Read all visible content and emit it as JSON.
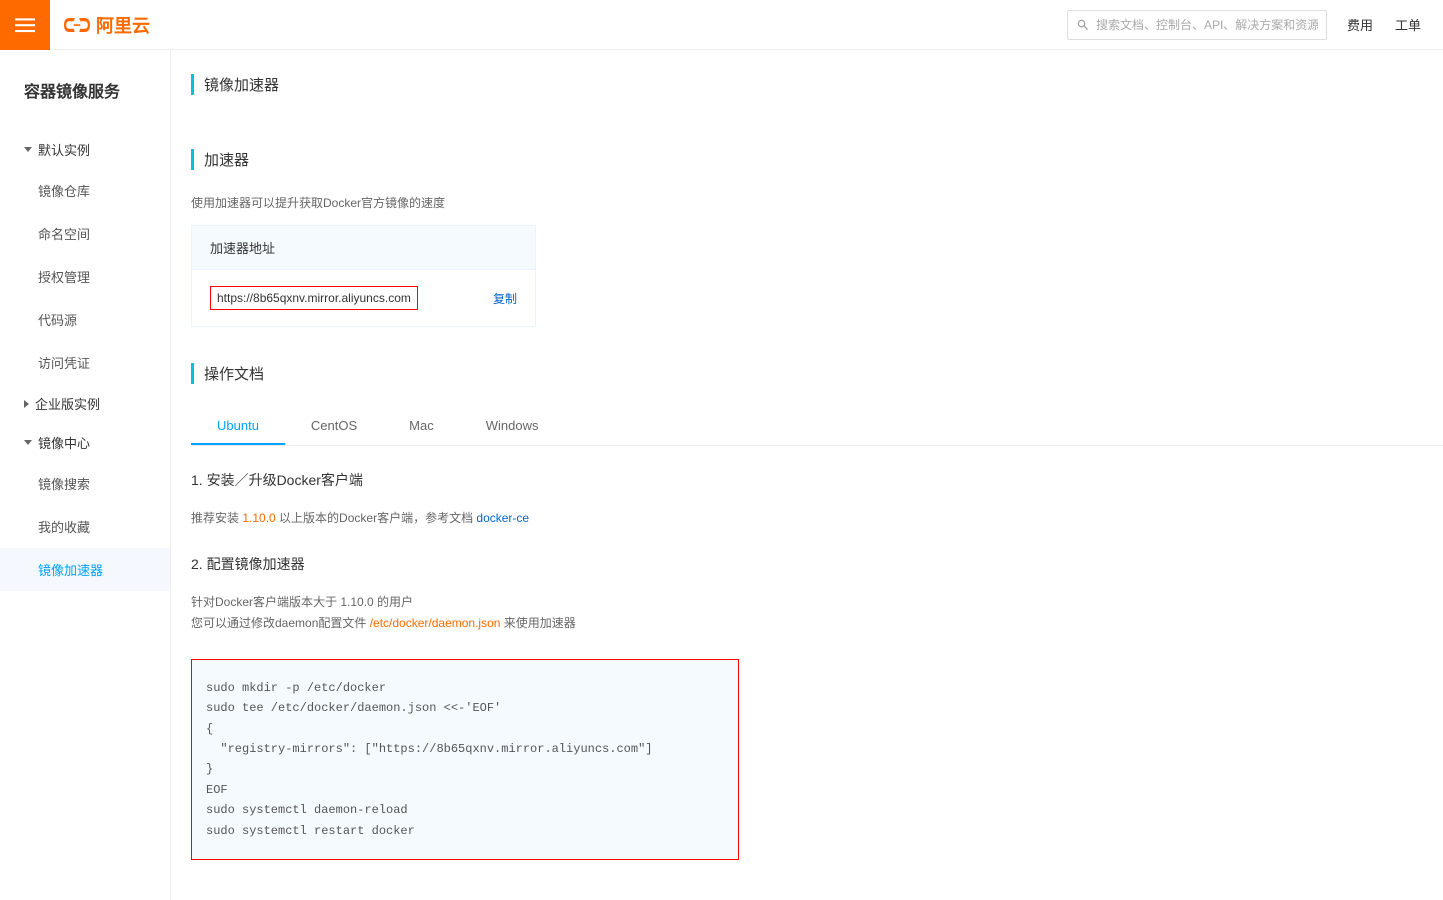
{
  "header": {
    "logo_text": "阿里云",
    "search_placeholder": "搜索文档、控制台、API、解决方案和资源",
    "links": [
      "费用",
      "工单"
    ]
  },
  "sidebar": {
    "service_title": "容器镜像服务",
    "groups": [
      {
        "label": "默认实例",
        "expanded": true,
        "items": [
          "镜像仓库",
          "命名空间",
          "授权管理",
          "代码源",
          "访问凭证"
        ]
      },
      {
        "label": "企业版实例",
        "expanded": false,
        "items": []
      },
      {
        "label": "镜像中心",
        "expanded": true,
        "items": [
          "镜像搜索",
          "我的收藏",
          "镜像加速器"
        ],
        "active_item": "镜像加速器"
      }
    ]
  },
  "main": {
    "page_title": "镜像加速器",
    "accelerator": {
      "section_label": "加速器",
      "desc": "使用加速器可以提升获取Docker官方镜像的速度",
      "addr_label": "加速器地址",
      "url": "https://8b65qxnv.mirror.aliyuncs.com",
      "copy_label": "复制"
    },
    "docs": {
      "section_label": "操作文档",
      "tabs": [
        "Ubuntu",
        "CentOS",
        "Mac",
        "Windows"
      ],
      "active_tab": "Ubuntu",
      "step1": {
        "title": "1. 安装／升级Docker客户端",
        "desc_prefix": "推荐安装 ",
        "version": "1.10.0",
        "desc_mid": " 以上版本的Docker客户端，参考文档 ",
        "link": "docker-ce"
      },
      "step2": {
        "title": "2. 配置镜像加速器",
        "desc1": "针对Docker客户端版本大于 1.10.0 的用户",
        "desc2_prefix": "您可以通过修改daemon配置文件 ",
        "path": "/etc/docker/daemon.json",
        "desc2_suffix": " 来使用加速器",
        "code": "sudo mkdir -p /etc/docker\nsudo tee /etc/docker/daemon.json <<-'EOF'\n{\n  \"registry-mirrors\": [\"https://8b65qxnv.mirror.aliyuncs.com\"]\n}\nEOF\nsudo systemctl daemon-reload\nsudo systemctl restart docker"
      }
    }
  }
}
